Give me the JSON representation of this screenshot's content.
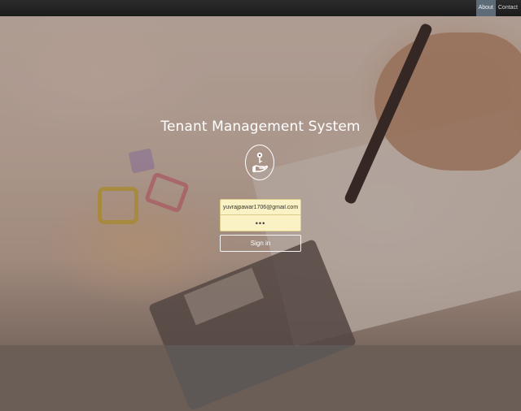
{
  "navbar": {
    "links": [
      {
        "label": "About",
        "active": true
      },
      {
        "label": "Contact",
        "active": false
      }
    ]
  },
  "login": {
    "title": "Tenant Management System",
    "logo_icon": "hand-with-key-icon",
    "email_value": "yuvrajpawar1706@gmail.com",
    "password_value": "•••",
    "signin_label": "Sign in"
  },
  "colors": {
    "navbar": "#222222",
    "active_nav": "#5e6b78",
    "field_bg": "#faf2c4",
    "text_light": "#ffffff"
  }
}
